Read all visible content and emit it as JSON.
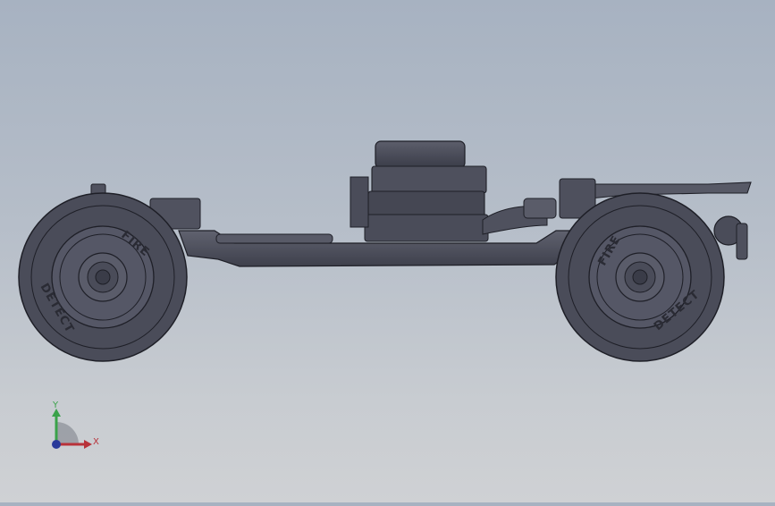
{
  "viewport": {
    "background_top": "#a7b2c1",
    "background_bottom": "#cfd1d4",
    "model_color": "#4c4e5c",
    "edge_color": "#1e1f27"
  },
  "wheels": [
    {
      "text_top": "FIRE",
      "text_bottom": "DETECT"
    },
    {
      "text_top": "FIRE",
      "text_bottom": "DETECT"
    }
  ],
  "triad": {
    "y_label": "Y",
    "x_label": "X",
    "y_color": "#3aa24a",
    "x_color": "#b8323a",
    "z_color": "#2a3a9a"
  }
}
